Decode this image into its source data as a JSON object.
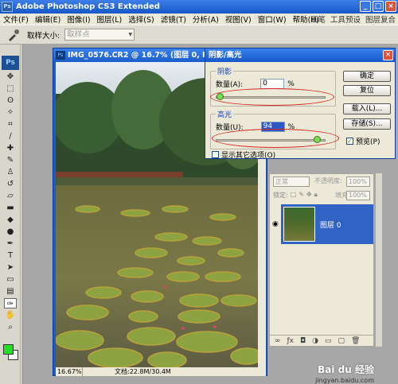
{
  "app": {
    "title": "Adobe Photoshop CS3 Extended",
    "logo": "Ps"
  },
  "menubar": {
    "items": [
      "文件(F)",
      "编辑(E)",
      "图像(I)",
      "图层(L)",
      "选择(S)",
      "滤镜(T)",
      "分析(A)",
      "视图(V)",
      "窗口(W)",
      "帮助(H)"
    ],
    "right": [
      "画笔",
      "工具预设",
      "图层复合"
    ]
  },
  "options": {
    "sample_label": "取样大小:",
    "sample_value": "取样点"
  },
  "document": {
    "title": "IMG_0576.CR2 @ 16.7% (图层 0, RGB/8)",
    "zoom": "16.67%",
    "doc_info": "文档:22.8M/30.4M"
  },
  "dialog": {
    "title": "阴影/高光",
    "shadows": {
      "legend": "阴影",
      "amount_label": "数量(A):",
      "amount_value": "0",
      "unit": "%",
      "level_pct": 0
    },
    "highlights": {
      "legend": "高光",
      "amount_label": "数量(U):",
      "amount_value": "94",
      "unit": "%",
      "level_pct": 94
    },
    "more_options": "显示其它选项(O)",
    "buttons": {
      "ok": "确定",
      "reset": "复位",
      "load": "载入(L)...",
      "save": "存储(S)...",
      "preview": "预览(P)"
    }
  },
  "layers": {
    "blend_mode": "正常",
    "opacity_label": "不透明度:",
    "opacity_value": "100%",
    "lock_label": "锁定:",
    "fill_label": "填充:",
    "fill_value": "100%",
    "layer_name": "图层 0"
  },
  "watermark": {
    "brand": "Bai du 经验",
    "url": "jingyan.baidu.com"
  },
  "colors": {
    "foreground": "#1fe11f",
    "background": "#ffffff",
    "title_blue": "#1a5ccc",
    "highlight_red": "#d9241c"
  }
}
